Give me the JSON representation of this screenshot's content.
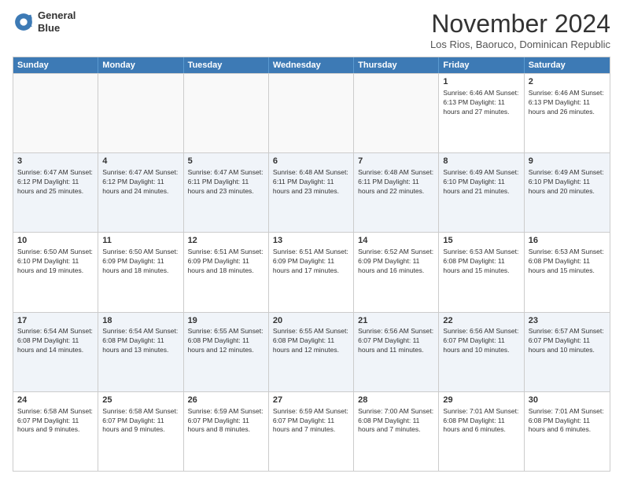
{
  "logo": {
    "line1": "General",
    "line2": "Blue"
  },
  "title": "November 2024",
  "location": "Los Rios, Baoruco, Dominican Republic",
  "weekdays": [
    "Sunday",
    "Monday",
    "Tuesday",
    "Wednesday",
    "Thursday",
    "Friday",
    "Saturday"
  ],
  "rows": [
    {
      "alt": false,
      "cells": [
        {
          "empty": true,
          "day": "",
          "info": ""
        },
        {
          "empty": true,
          "day": "",
          "info": ""
        },
        {
          "empty": true,
          "day": "",
          "info": ""
        },
        {
          "empty": true,
          "day": "",
          "info": ""
        },
        {
          "empty": true,
          "day": "",
          "info": ""
        },
        {
          "empty": false,
          "day": "1",
          "info": "Sunrise: 6:46 AM\nSunset: 6:13 PM\nDaylight: 11 hours\nand 27 minutes."
        },
        {
          "empty": false,
          "day": "2",
          "info": "Sunrise: 6:46 AM\nSunset: 6:13 PM\nDaylight: 11 hours\nand 26 minutes."
        }
      ]
    },
    {
      "alt": true,
      "cells": [
        {
          "empty": false,
          "day": "3",
          "info": "Sunrise: 6:47 AM\nSunset: 6:12 PM\nDaylight: 11 hours\nand 25 minutes."
        },
        {
          "empty": false,
          "day": "4",
          "info": "Sunrise: 6:47 AM\nSunset: 6:12 PM\nDaylight: 11 hours\nand 24 minutes."
        },
        {
          "empty": false,
          "day": "5",
          "info": "Sunrise: 6:47 AM\nSunset: 6:11 PM\nDaylight: 11 hours\nand 23 minutes."
        },
        {
          "empty": false,
          "day": "6",
          "info": "Sunrise: 6:48 AM\nSunset: 6:11 PM\nDaylight: 11 hours\nand 23 minutes."
        },
        {
          "empty": false,
          "day": "7",
          "info": "Sunrise: 6:48 AM\nSunset: 6:11 PM\nDaylight: 11 hours\nand 22 minutes."
        },
        {
          "empty": false,
          "day": "8",
          "info": "Sunrise: 6:49 AM\nSunset: 6:10 PM\nDaylight: 11 hours\nand 21 minutes."
        },
        {
          "empty": false,
          "day": "9",
          "info": "Sunrise: 6:49 AM\nSunset: 6:10 PM\nDaylight: 11 hours\nand 20 minutes."
        }
      ]
    },
    {
      "alt": false,
      "cells": [
        {
          "empty": false,
          "day": "10",
          "info": "Sunrise: 6:50 AM\nSunset: 6:10 PM\nDaylight: 11 hours\nand 19 minutes."
        },
        {
          "empty": false,
          "day": "11",
          "info": "Sunrise: 6:50 AM\nSunset: 6:09 PM\nDaylight: 11 hours\nand 18 minutes."
        },
        {
          "empty": false,
          "day": "12",
          "info": "Sunrise: 6:51 AM\nSunset: 6:09 PM\nDaylight: 11 hours\nand 18 minutes."
        },
        {
          "empty": false,
          "day": "13",
          "info": "Sunrise: 6:51 AM\nSunset: 6:09 PM\nDaylight: 11 hours\nand 17 minutes."
        },
        {
          "empty": false,
          "day": "14",
          "info": "Sunrise: 6:52 AM\nSunset: 6:09 PM\nDaylight: 11 hours\nand 16 minutes."
        },
        {
          "empty": false,
          "day": "15",
          "info": "Sunrise: 6:53 AM\nSunset: 6:08 PM\nDaylight: 11 hours\nand 15 minutes."
        },
        {
          "empty": false,
          "day": "16",
          "info": "Sunrise: 6:53 AM\nSunset: 6:08 PM\nDaylight: 11 hours\nand 15 minutes."
        }
      ]
    },
    {
      "alt": true,
      "cells": [
        {
          "empty": false,
          "day": "17",
          "info": "Sunrise: 6:54 AM\nSunset: 6:08 PM\nDaylight: 11 hours\nand 14 minutes."
        },
        {
          "empty": false,
          "day": "18",
          "info": "Sunrise: 6:54 AM\nSunset: 6:08 PM\nDaylight: 11 hours\nand 13 minutes."
        },
        {
          "empty": false,
          "day": "19",
          "info": "Sunrise: 6:55 AM\nSunset: 6:08 PM\nDaylight: 11 hours\nand 12 minutes."
        },
        {
          "empty": false,
          "day": "20",
          "info": "Sunrise: 6:55 AM\nSunset: 6:08 PM\nDaylight: 11 hours\nand 12 minutes."
        },
        {
          "empty": false,
          "day": "21",
          "info": "Sunrise: 6:56 AM\nSunset: 6:07 PM\nDaylight: 11 hours\nand 11 minutes."
        },
        {
          "empty": false,
          "day": "22",
          "info": "Sunrise: 6:56 AM\nSunset: 6:07 PM\nDaylight: 11 hours\nand 10 minutes."
        },
        {
          "empty": false,
          "day": "23",
          "info": "Sunrise: 6:57 AM\nSunset: 6:07 PM\nDaylight: 11 hours\nand 10 minutes."
        }
      ]
    },
    {
      "alt": false,
      "cells": [
        {
          "empty": false,
          "day": "24",
          "info": "Sunrise: 6:58 AM\nSunset: 6:07 PM\nDaylight: 11 hours\nand 9 minutes."
        },
        {
          "empty": false,
          "day": "25",
          "info": "Sunrise: 6:58 AM\nSunset: 6:07 PM\nDaylight: 11 hours\nand 9 minutes."
        },
        {
          "empty": false,
          "day": "26",
          "info": "Sunrise: 6:59 AM\nSunset: 6:07 PM\nDaylight: 11 hours\nand 8 minutes."
        },
        {
          "empty": false,
          "day": "27",
          "info": "Sunrise: 6:59 AM\nSunset: 6:07 PM\nDaylight: 11 hours\nand 7 minutes."
        },
        {
          "empty": false,
          "day": "28",
          "info": "Sunrise: 7:00 AM\nSunset: 6:08 PM\nDaylight: 11 hours\nand 7 minutes."
        },
        {
          "empty": false,
          "day": "29",
          "info": "Sunrise: 7:01 AM\nSunset: 6:08 PM\nDaylight: 11 hours\nand 6 minutes."
        },
        {
          "empty": false,
          "day": "30",
          "info": "Sunrise: 7:01 AM\nSunset: 6:08 PM\nDaylight: 11 hours\nand 6 minutes."
        }
      ]
    }
  ]
}
